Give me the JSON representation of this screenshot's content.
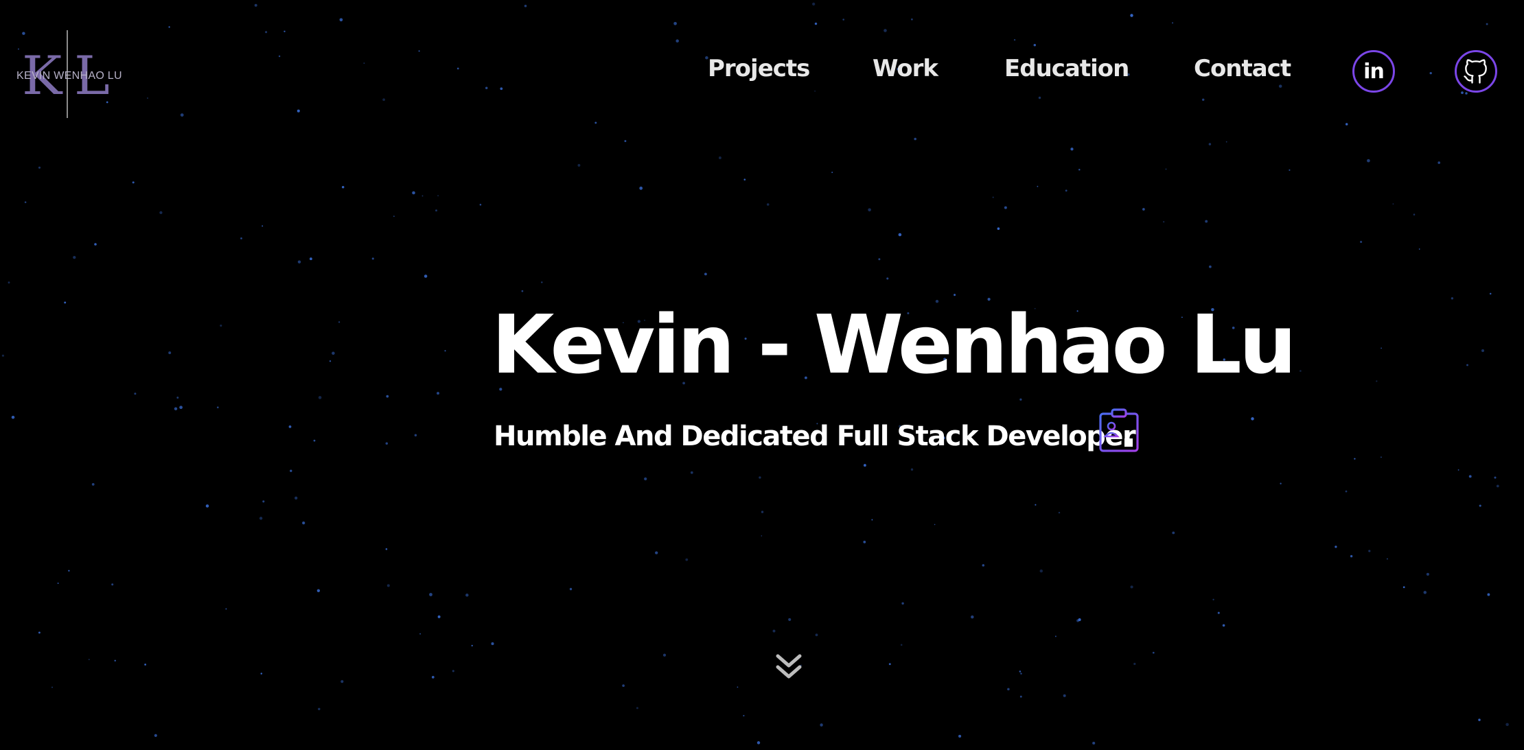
{
  "logo": {
    "letters": [
      "K",
      "L"
    ],
    "text": "KEVIN WENHAO LU",
    "color": "#7a6aa8"
  },
  "nav": {
    "links": [
      {
        "label": "Projects"
      },
      {
        "label": "Work"
      },
      {
        "label": "Education"
      },
      {
        "label": "Contact"
      }
    ],
    "social": [
      {
        "icon": "linkedin-icon",
        "label": "in"
      },
      {
        "icon": "github-icon"
      }
    ]
  },
  "hero": {
    "title": "Kevin - Wenhao Lu",
    "subtitle": "Humble And Dedicated Full Stack Developer",
    "resume_icon": "resume-icon"
  },
  "scroll_icon": "chevron-double-down-icon",
  "colors": {
    "background": "#000000",
    "accent": "#7b46e8",
    "accent_secondary": "#4b6cf0",
    "text": "#ffffff",
    "nav_text": "#e8e8e8",
    "star": "#3a6fd8"
  }
}
